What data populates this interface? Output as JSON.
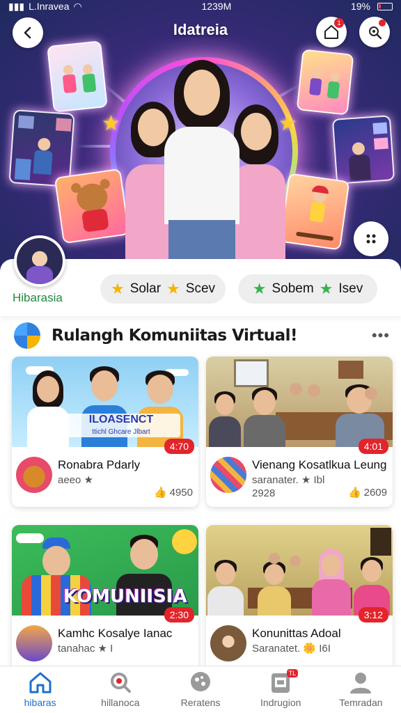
{
  "status_bar": {
    "carrier": "L.Inravea",
    "time": "1239M",
    "battery": "19%"
  },
  "header": {
    "title": "Idatreia",
    "notification_count": "1"
  },
  "profile": {
    "name": "Hibarasia"
  },
  "pills": [
    {
      "label_a": "Solar",
      "label_b": "Scev"
    },
    {
      "label_a": "Sobem",
      "label_b": "Isev"
    }
  ],
  "section": {
    "title": "Rulangh Komuniitas Virtual!",
    "more": "•••"
  },
  "cards": [
    {
      "banner": "ILOASENCT",
      "banner_sub": "ttichl Ghcare Jlbart",
      "duration": "4:70",
      "title": "Ronabra Pdarly",
      "sub": "aeeo ★",
      "sub2": "",
      "likes": "4950"
    },
    {
      "banner": "",
      "banner_sub": "",
      "duration": "4:01",
      "title": "Vienang Kosatlkua Leung",
      "sub": "saranater. ★ Ibl",
      "sub2": "2928",
      "likes": "2609"
    },
    {
      "banner": "KOMUNIISIA",
      "banner_sub": "",
      "duration": "2:30",
      "title": "Kamhc Kosalye Ianac",
      "sub": "tanahac ★ I",
      "sub2": "",
      "likes": ""
    },
    {
      "banner": "",
      "banner_sub": "",
      "duration": "3:12",
      "title": "Konunittas Adoal",
      "sub": "Saranatet. 🌼 I6I",
      "sub2": "",
      "likes": ""
    }
  ],
  "bottom_nav": [
    {
      "label": "hibaras",
      "active": true,
      "badge": ""
    },
    {
      "label": "hillanoca",
      "active": false,
      "badge": ""
    },
    {
      "label": "Reratens",
      "active": false,
      "badge": ""
    },
    {
      "label": "Indrugion",
      "active": false,
      "badge": "TL"
    },
    {
      "label": "Temradan",
      "active": false,
      "badge": ""
    }
  ],
  "colors": {
    "accent": "#1a6fd1",
    "badge": "#e3242b",
    "profile_name": "#1e8b3d"
  }
}
